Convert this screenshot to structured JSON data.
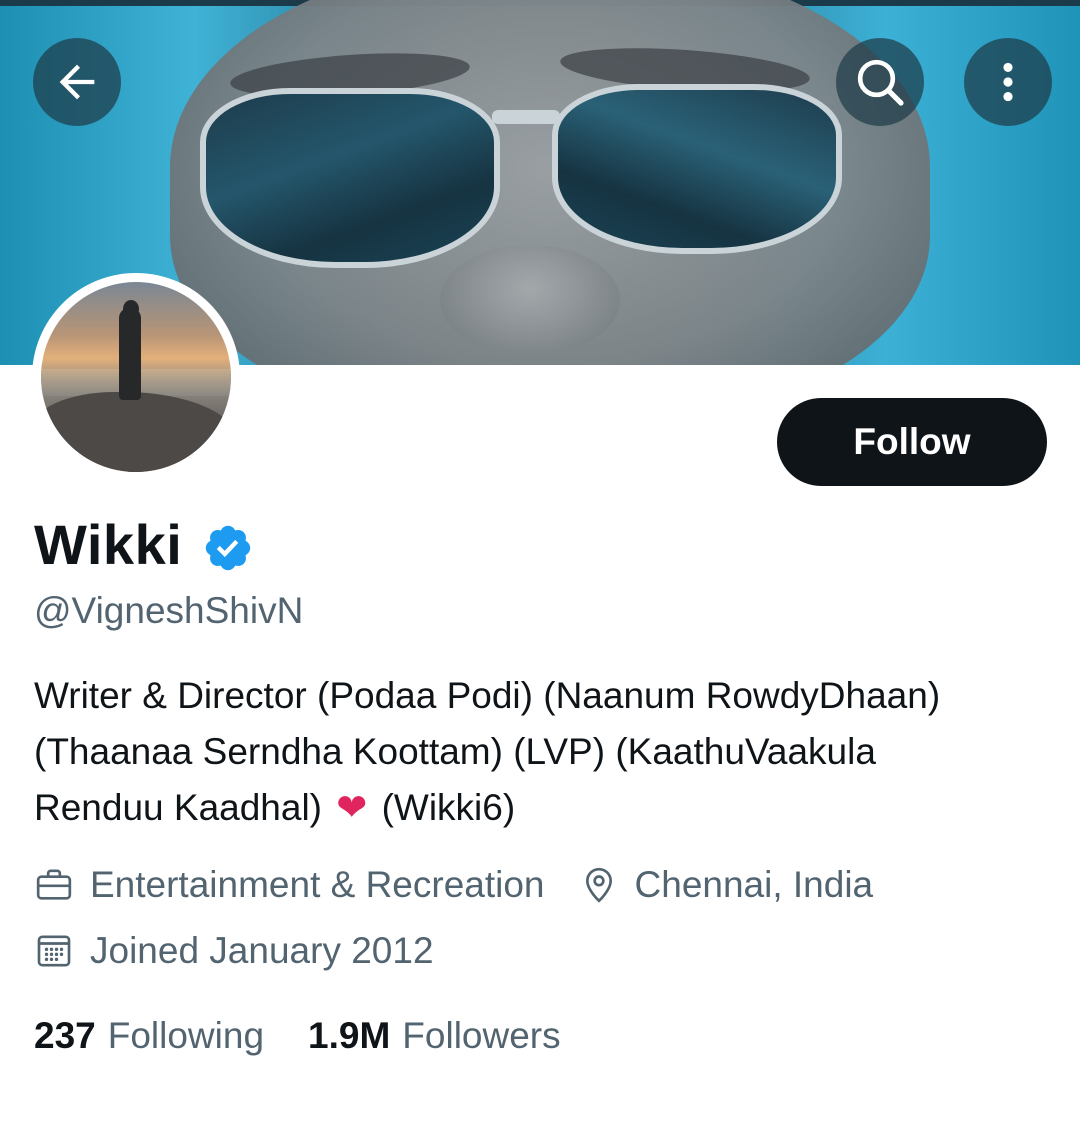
{
  "header": {
    "back_icon": "arrow-left-icon",
    "search_icon": "search-icon",
    "more_icon": "more-vertical-icon"
  },
  "profile": {
    "display_name": "Wikki",
    "verified": true,
    "handle": "@VigneshShivN",
    "follow_label": "Follow",
    "bio": {
      "line1": "Writer & Director (Podaa Podi) (Naanum RowdyDhaan)",
      "line2": "(Thaanaa Serndha Koottam) (LVP) (KaathuVaakula",
      "line3_start": "Renduu Kaadhal)",
      "heart_emoji": "❤",
      "line3_end": "(Wikki6)"
    },
    "category": "Entertainment & Recreation",
    "location": "Chennai, India",
    "joined": "Joined January 2012",
    "following_count": "237",
    "following_label": "Following",
    "followers_count": "1.9M",
    "followers_label": "Followers"
  },
  "colors": {
    "primary_text": "#0f1419",
    "secondary_text": "#536471",
    "verified_blue": "#1d9bf0",
    "follow_button_bg": "#0f1419",
    "heart": "#e0245e"
  }
}
